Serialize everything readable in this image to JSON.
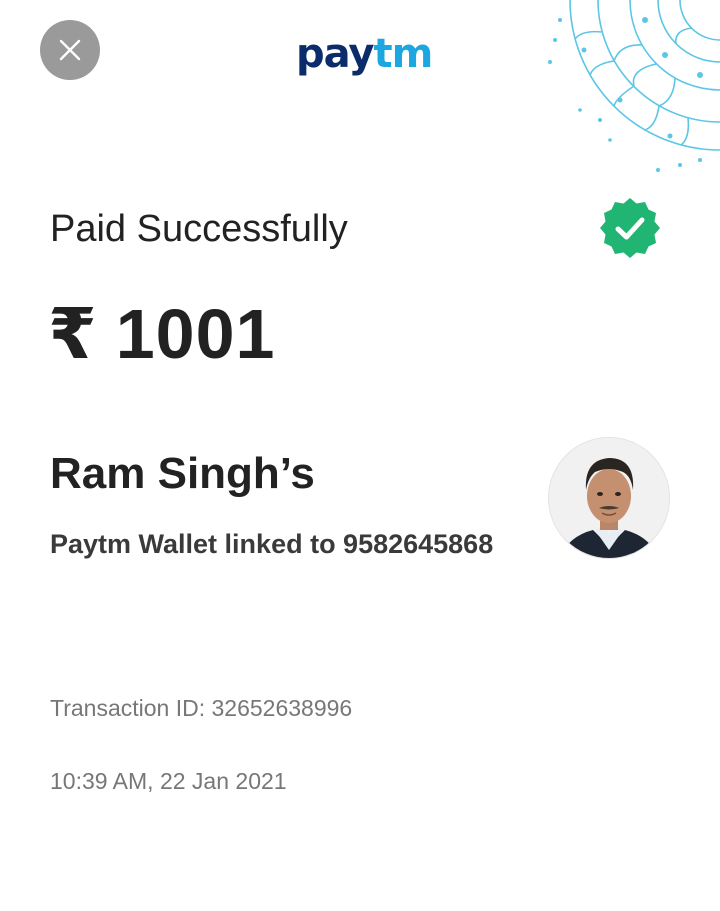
{
  "header": {
    "close_icon": "close-icon",
    "logo_pay": "pay",
    "logo_tm": "tm"
  },
  "payment": {
    "status": "Paid Successfully",
    "status_icon": "verified-check-icon",
    "currency_symbol": "₹",
    "amount": "1001"
  },
  "payee": {
    "name": "Ram Singh’s",
    "subtitle": "Paytm Wallet linked to 9582645868",
    "avatar": "profile-photo"
  },
  "transaction": {
    "id_text": "Transaction ID: 32652638996",
    "datetime": "10:39 AM, 22 Jan 2021"
  },
  "colors": {
    "paytm_dark_blue": "#0b2b6b",
    "paytm_light_blue": "#1ca7e0",
    "success_green": "#21b573",
    "close_button_gray": "#9a9a9a"
  }
}
